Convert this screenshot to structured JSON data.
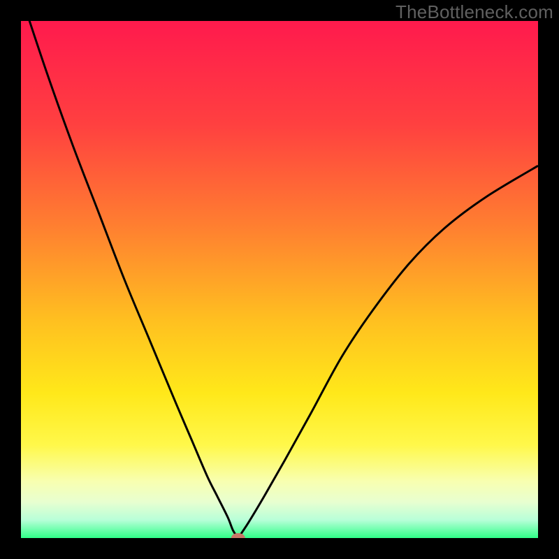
{
  "watermark": "TheBottleneck.com",
  "colors": {
    "frame": "#000000",
    "curve": "#000000",
    "marker_fill": "#c87868",
    "gradient_stops": [
      {
        "offset": 0.0,
        "color": "#ff1a4d"
      },
      {
        "offset": 0.2,
        "color": "#ff4040"
      },
      {
        "offset": 0.4,
        "color": "#ff8030"
      },
      {
        "offset": 0.58,
        "color": "#ffc020"
      },
      {
        "offset": 0.72,
        "color": "#ffe81a"
      },
      {
        "offset": 0.82,
        "color": "#fff84a"
      },
      {
        "offset": 0.89,
        "color": "#f8ffb0"
      },
      {
        "offset": 0.93,
        "color": "#e8ffd0"
      },
      {
        "offset": 0.965,
        "color": "#b8ffd8"
      },
      {
        "offset": 1.0,
        "color": "#30ff88"
      }
    ]
  },
  "chart_data": {
    "type": "line",
    "title": "",
    "xlabel": "",
    "ylabel": "",
    "xlim": [
      0,
      100
    ],
    "ylim": [
      0,
      100
    ],
    "x_min_at": 42,
    "marker": {
      "x": 42,
      "y": 0
    },
    "curve_left": {
      "comment": "Left branch, starts at top-left, descends convexly to the minimum",
      "x": [
        0,
        5,
        10,
        15,
        20,
        25,
        30,
        33,
        36,
        38,
        40,
        41,
        42
      ],
      "y": [
        105,
        90,
        76,
        63,
        50,
        38,
        26,
        19,
        12,
        8,
        4,
        1.5,
        0
      ]
    },
    "curve_right": {
      "comment": "Right branch, rises more gently, concave-down, exits at right edge ~72% height",
      "x": [
        42,
        44,
        47,
        51,
        56,
        62,
        68,
        75,
        82,
        90,
        100
      ],
      "y": [
        0,
        3,
        8,
        15,
        24,
        35,
        44,
        53,
        60,
        66,
        72
      ]
    }
  }
}
